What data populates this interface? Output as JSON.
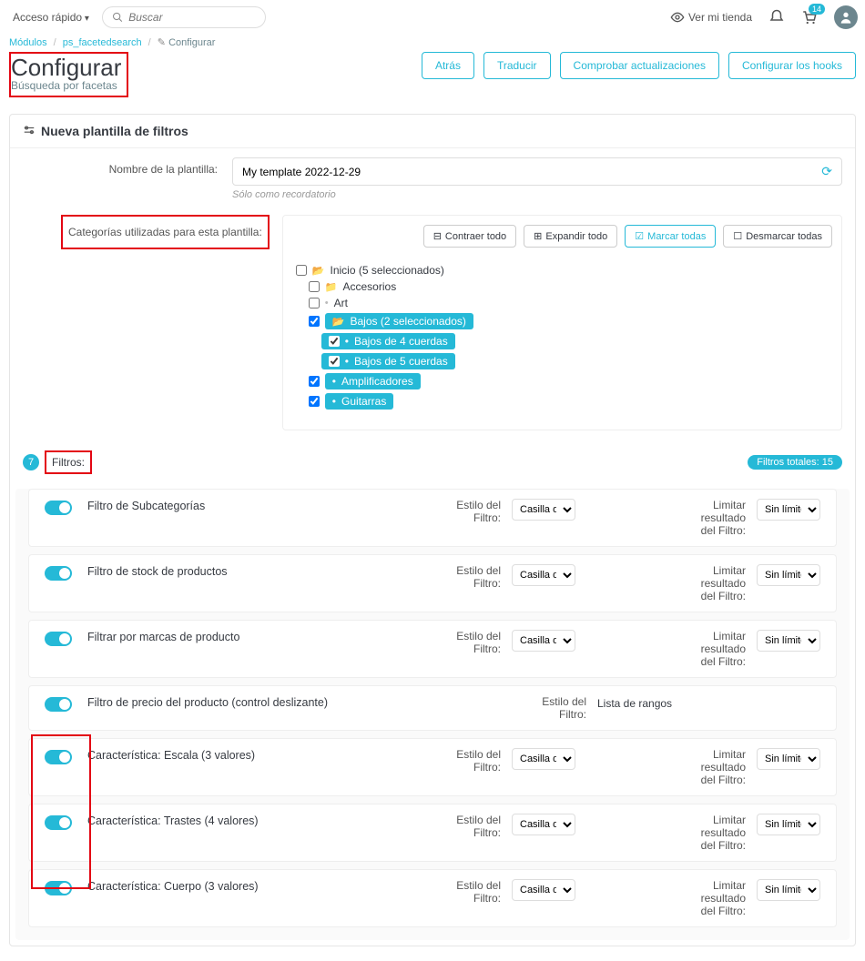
{
  "topbar": {
    "quick_access": "Acceso rápido",
    "search_placeholder": "Buscar",
    "view_shop": "Ver mi tienda",
    "cart_badge": "14"
  },
  "breadcrumb": {
    "modules": "Módulos",
    "module": "ps_facetedsearch",
    "page": "Configurar"
  },
  "page": {
    "title": "Configurar",
    "subtitle": "Búsqueda por facetas"
  },
  "buttons": {
    "back": "Atrás",
    "translate": "Traducir",
    "check_updates": "Comprobar actualizaciones",
    "configure_hooks": "Configurar los hooks"
  },
  "panel": {
    "title": "Nueva plantilla de filtros"
  },
  "form": {
    "name_label": "Nombre de la plantilla:",
    "name_value": "My template 2022-12-29",
    "name_help": "Sólo como recordatorio",
    "categories_label": "Categorías utilizadas para esta plantilla:"
  },
  "tree_buttons": {
    "collapse": "Contraer todo",
    "expand": "Expandir todo",
    "check_all": "Marcar todas",
    "uncheck_all": "Desmarcar todas"
  },
  "tree": {
    "root": "Inicio (5 seleccionados)",
    "accessories": "Accesorios",
    "art": "Art",
    "bajos": "Bajos (2 seleccionados)",
    "bajos4": "Bajos de 4 cuerdas",
    "bajos5": "Bajos de 5 cuerdas",
    "amplificadores": "Amplificadores",
    "guitarras": "Guitarras"
  },
  "filters_head": {
    "count": "7",
    "label": "Filtros:",
    "total": "Filtros totales: 15"
  },
  "filters": {
    "style_label1": "Estilo del",
    "style_label2": "Filtro:",
    "limit_label1": "Limitar",
    "limit_label2": "resultado",
    "limit_label3": "del Filtro:",
    "select_style": "Casilla de",
    "select_limit": "Sin límite",
    "range_list": "Lista de rangos",
    "rows": [
      {
        "name": "Filtro de Subcategorías"
      },
      {
        "name": "Filtro de stock de productos"
      },
      {
        "name": "Filtrar por marcas de producto"
      },
      {
        "name": "Filtro de precio del producto (control deslizante)"
      },
      {
        "name": "Característica: Escala (3 valores)"
      },
      {
        "name": "Característica: Trastes (4 valores)"
      },
      {
        "name": "Característica: Cuerpo (3 valores)"
      }
    ]
  }
}
